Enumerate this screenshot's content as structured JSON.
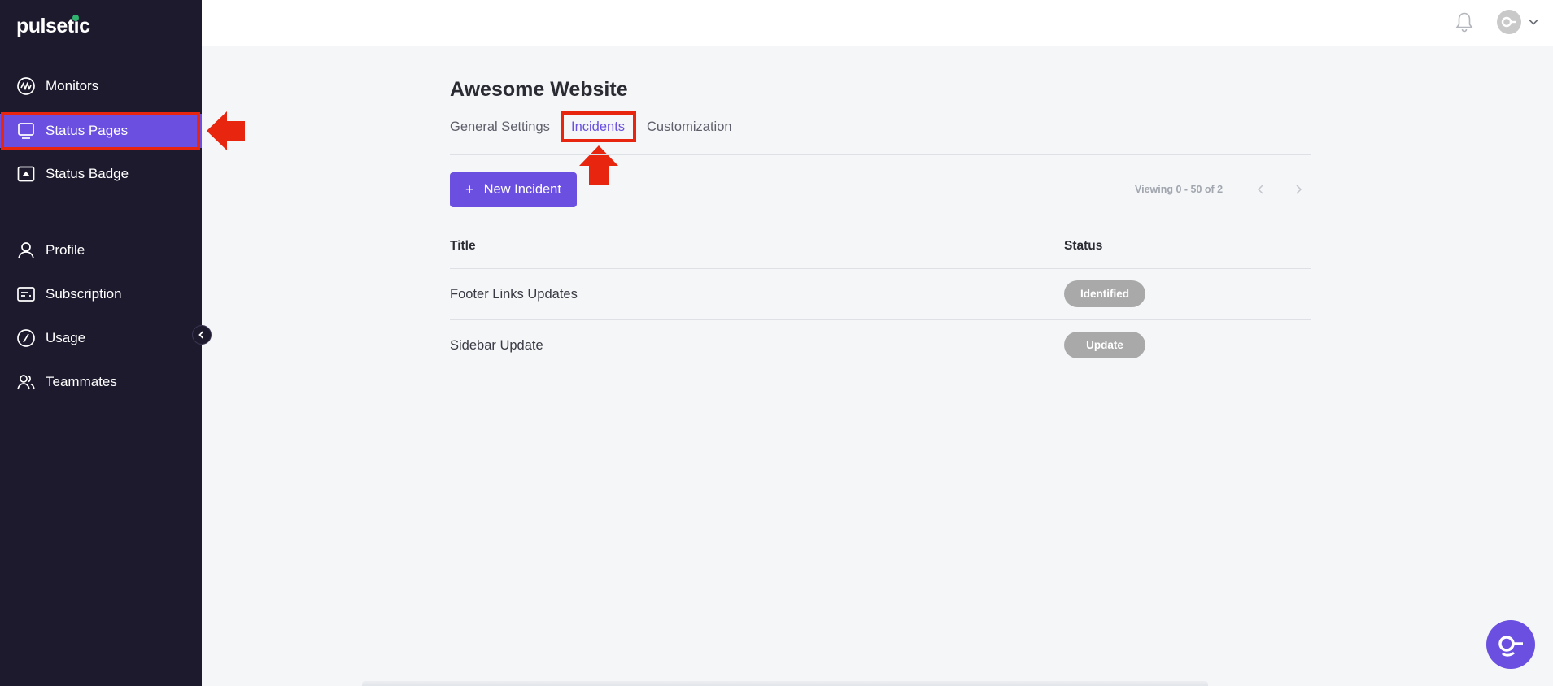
{
  "app": {
    "logo": "pulsetic"
  },
  "sidebar": {
    "items": [
      {
        "label": "Monitors",
        "icon": "monitors-wave-icon"
      },
      {
        "label": "Status Pages",
        "icon": "status-pages-icon",
        "active": true
      },
      {
        "label": "Status Badge",
        "icon": "status-badge-icon"
      },
      {
        "label": "Profile",
        "icon": "profile-icon"
      },
      {
        "label": "Subscription",
        "icon": "subscription-card-icon"
      },
      {
        "label": "Usage",
        "icon": "usage-gauge-icon"
      },
      {
        "label": "Teammates",
        "icon": "teammates-icon"
      }
    ]
  },
  "header": {
    "bell_icon": "bell-icon",
    "avatar_icon": "user-avatar-icon"
  },
  "main": {
    "title": "Awesome Website",
    "tabs": [
      {
        "label": "General Settings"
      },
      {
        "label": "Incidents",
        "active": true
      },
      {
        "label": "Customization"
      }
    ],
    "new_incident_label": "New Incident",
    "viewing": "Viewing 0 - 50 of 2",
    "table": {
      "columns": [
        "Title",
        "Status"
      ],
      "rows": [
        {
          "title": "Footer Links Updates",
          "status": "Identified"
        },
        {
          "title": "Sidebar Update",
          "status": "Update"
        }
      ]
    }
  },
  "colors": {
    "accent": "#6a4fe0",
    "sidebar_bg": "#1d1a2e",
    "annotation": "#e8250f",
    "badge_bg": "#a9a9a9"
  }
}
